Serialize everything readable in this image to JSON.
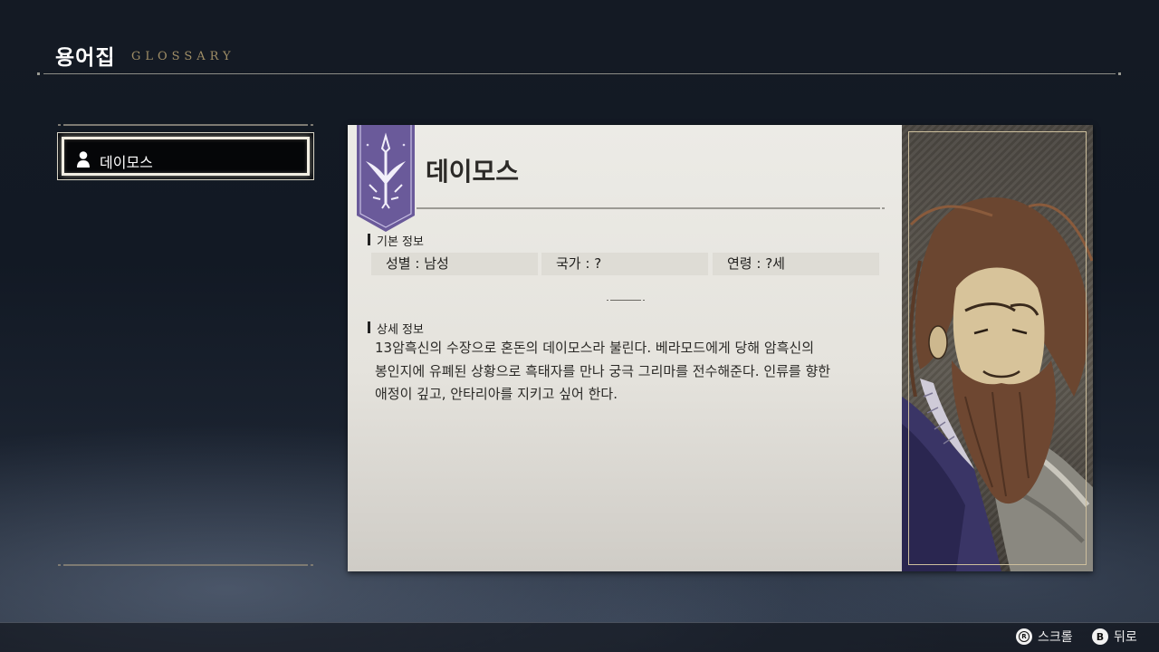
{
  "header": {
    "title": "용어집",
    "subtitle": "GLOSSARY"
  },
  "list": {
    "items": [
      {
        "label": "데이모스",
        "icon": "person-icon",
        "selected": true
      }
    ]
  },
  "entry": {
    "name": "데이모스",
    "emblem_icon": "dark-star-emblem-icon",
    "basic_info_title": "기본 정보",
    "basic_info": {
      "gender": "성별 : 남성",
      "country": "국가 : ?",
      "age": "연령 : ?세"
    },
    "detail_title": "상세 정보",
    "detail_text": "13암흑신의 수장으로 혼돈의 데이모스라 불린다. 베라모드에게 당해 암흑신의\n봉인지에 유폐된 상황으로 흑태자를 만나 궁극 그리마를 전수해준다. 인류를 향한\n애정이 깊고, 안타리아를 지키고 싶어 한다."
  },
  "footer": {
    "hints": [
      {
        "button": "R",
        "label": "스크롤"
      },
      {
        "button": "B",
        "label": "뒤로"
      }
    ]
  },
  "colors": {
    "accent_gold": "#a08e66",
    "banner_purple": "#6a5a9a",
    "card_bg": "#e9e8e3"
  }
}
